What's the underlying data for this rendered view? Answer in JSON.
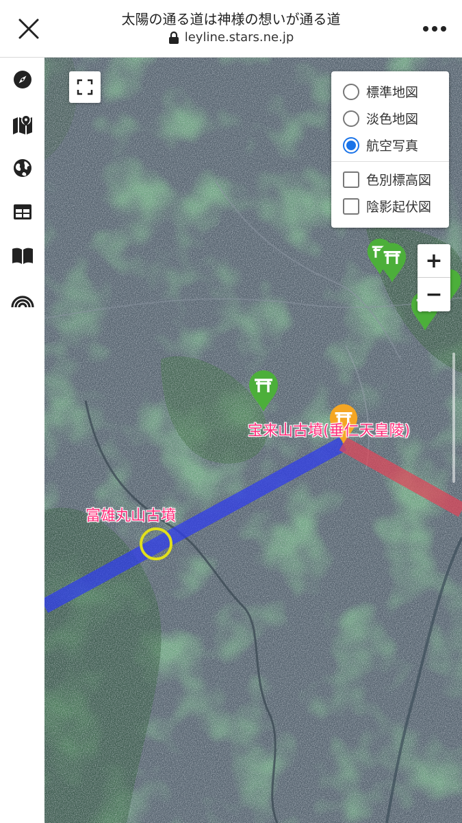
{
  "browser": {
    "title": "太陽の通る道は神様の想いが通る道",
    "url": "leyline.stars.ne.jp"
  },
  "sidebar": {
    "items": [
      {
        "icon": "compass-icon"
      },
      {
        "icon": "map-icon"
      },
      {
        "icon": "globe-icon"
      },
      {
        "icon": "table-icon"
      },
      {
        "icon": "book-icon"
      },
      {
        "icon": "rainbow-icon"
      }
    ]
  },
  "layers": {
    "base": [
      {
        "label": "標準地図",
        "selected": false
      },
      {
        "label": "淡色地図",
        "selected": false
      },
      {
        "label": "航空写真",
        "selected": true
      }
    ],
    "overlays": [
      {
        "label": "色別標高図",
        "checked": false
      },
      {
        "label": "陰影起伏図",
        "checked": false
      }
    ]
  },
  "zoom": {
    "in": "+",
    "out": "−"
  },
  "map": {
    "labels": {
      "houraisan": "宝来山古墳(垂仁天皇陵)",
      "tomio": "富雄丸山古墳"
    },
    "colors": {
      "blue_line": "#2f3df0",
      "red_line": "#e0475a",
      "shrine_marker": "#4caf3a",
      "tomb_marker": "#f5a623",
      "circle": "#e1e01c"
    }
  }
}
